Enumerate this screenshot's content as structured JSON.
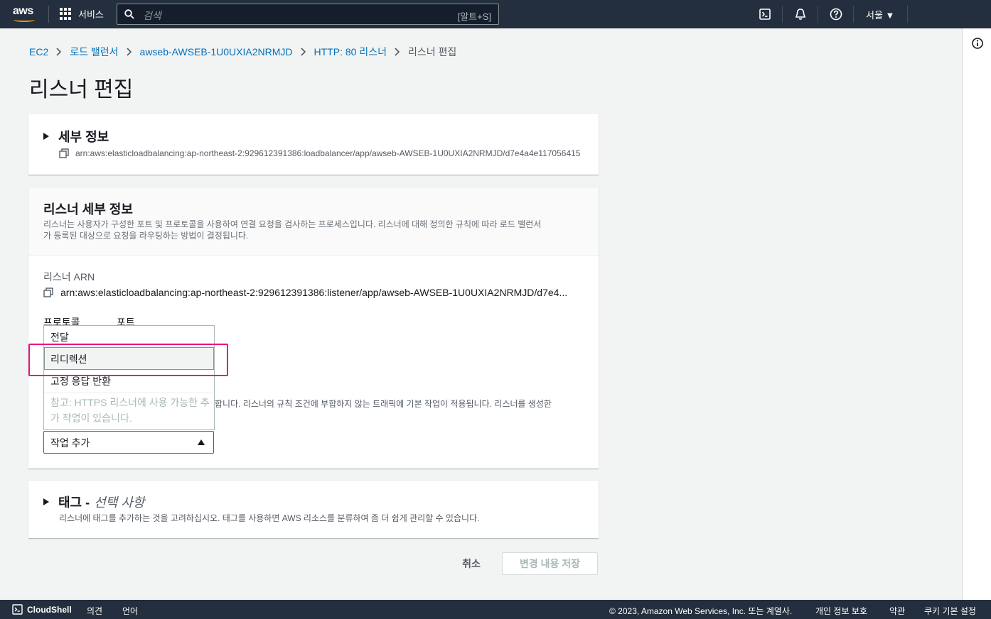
{
  "nav": {
    "logo": "aws",
    "services": "서비스",
    "search_placeholder": "검색",
    "search_shortcut": "[알트+S]",
    "region": "서울 ▼",
    "icons": [
      "cloudshell-icon",
      "bell-icon",
      "help-icon",
      "info-icon"
    ]
  },
  "breadcrumb": {
    "items": [
      "EC2",
      "로드 밸런서",
      "awseb-AWSEB-1U0UXIA2NRMJD",
      "HTTP: 80 리스너"
    ],
    "current": "리스너 편집"
  },
  "page": {
    "title": "리스너 편집"
  },
  "details_panel": {
    "title": "세부 정보",
    "arn": "arn:aws:elasticloadbalancing:ap-northeast-2:929612391386:loadbalancer/app/awseb-AWSEB-1U0UXIA2NRMJD/d7e4a4e117056415"
  },
  "listener_panel": {
    "title": "리스너 세부 정보",
    "description_line1": "리스너는 사용자가 구성한 포트 및 프로토콜을 사용하여 연결 요청을 검사하는 프로세스입니다. 리스너에 대해 정의한 규칙에 따라 로드 밸런서",
    "description_line2": "가 등록된 대상으로 요청을 라우팅하는 방법이 결정됩니다.",
    "arn_label": "리스너 ARN",
    "arn": "arn:aws:elasticloadbalancing:ap-northeast-2:929612391386:listener/app/awseb-AWSEB-1U0UXIA2NRMJD/d7e4...",
    "protocol_label": "프로토콜",
    "port_label": "포트",
    "default_action_text": "합니다. 리스너의 규칙 조건에 부합하지 않는 트래픽에 기본 작업이 적용됩니다. 리스너를 생성한",
    "dropdown": {
      "options": [
        "전달",
        "리디렉션",
        "고정 응답 반환"
      ],
      "selected": "리디렉션",
      "note": "참고: HTTPS 리스너에 사용 가능한 추가 작업이 있습니다."
    },
    "add_action": "작업 추가"
  },
  "tags_panel": {
    "title": "태그 -",
    "title_optional": "선택 사항",
    "description": "리스너에 태그를 추가하는 것을 고려하십시오. 태그를 사용하면 AWS 리소스를 분류하여 좀 더 쉽게 관리할 수 있습니다."
  },
  "actions": {
    "cancel": "취소",
    "save": "변경 내용 저장"
  },
  "footer": {
    "cloudshell": "CloudShell",
    "feedback": "의견",
    "language": "언어",
    "copyright": "© 2023, Amazon Web Services, Inc. 또는 계열사.",
    "privacy": "개인 정보 보호",
    "terms": "약관",
    "cookies": "쿠키 기본 설정"
  }
}
